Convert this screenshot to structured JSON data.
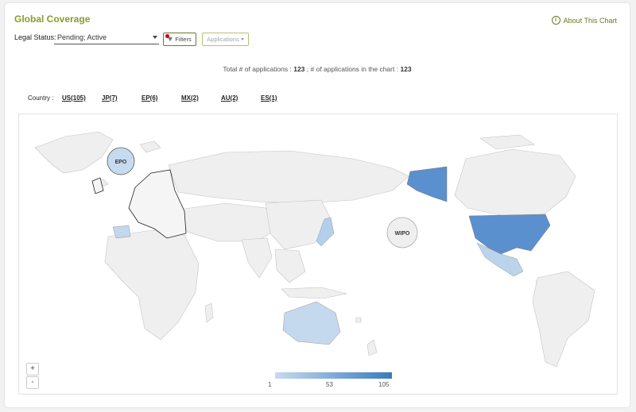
{
  "header": {
    "title": "Global Coverage",
    "about": "About This Chart",
    "info_glyph": "i"
  },
  "filters": {
    "legal_status_label": "Legal Status:",
    "legal_status_value": "Pending; Active",
    "filters_label": "Filters",
    "applications_label": "Applications"
  },
  "totals": {
    "prefix": "Total # of applications :",
    "total": "123",
    "mid": "; # of applications in the chart :",
    "in_chart": "123"
  },
  "country_bar": {
    "label": "Country :",
    "items": [
      "US(105)",
      "JP(7)",
      "EP(6)",
      "MX(2)",
      "AU(2)",
      "ES(1)"
    ]
  },
  "map": {
    "epo_label": "EPO",
    "wipo_label": "WIPO",
    "zoom_in": "+",
    "zoom_out": "-",
    "legend": {
      "min": "1",
      "mid": "53",
      "max": "105",
      "color_low": "#c6dbef",
      "color_high": "#3a7abf"
    },
    "colors": {
      "land": "#efefef",
      "stroke": "#c4c4c4",
      "us": "#5b90cf",
      "jp": "#b4cfeb",
      "mx": "#bcd3ec",
      "au": "#c4d8ee",
      "es": "#c3d7ed",
      "epo": "#c6dbef",
      "wipo": "#efefef"
    }
  }
}
